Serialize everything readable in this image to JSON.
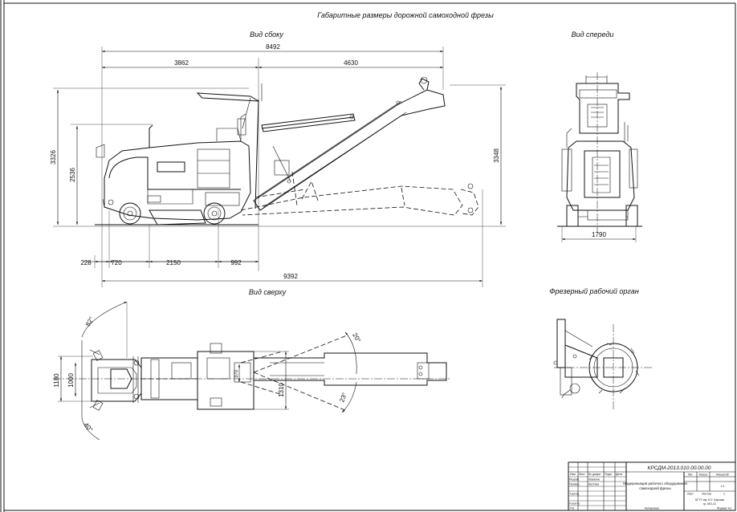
{
  "drawing": {
    "main_title": "Габаритные размеры дорожной самоходной фрезы",
    "views": {
      "side": "Вид сбоку",
      "front": "Вид спереди",
      "top": "Вид сверху",
      "cutter": "Фрезерный рабочий орган"
    }
  },
  "dimensions": {
    "side": {
      "overall_top": "8492",
      "upper_left": "3862",
      "upper_right": "4630",
      "height_total": "3326",
      "height_cab": "2536",
      "height_conveyor": "3348",
      "bottom_1": "228",
      "bottom_2": "720",
      "bottom_3": "2150",
      "bottom_4": "992",
      "overall_bottom": "9392"
    },
    "front": {
      "width": "1790"
    },
    "top": {
      "width_outer": "1180",
      "width_inner": "1000",
      "track": "1310",
      "small": "370",
      "angle_upper_left": "82°",
      "angle_lower_left": "40°",
      "angle_upper_right": "20°",
      "angle_lower_right": "23°"
    }
  },
  "title_block": {
    "designation": "КРСДМ-2013.010.00.00.00",
    "name_line1": "Модернизация рабочего оборудования",
    "name_line2": "самоходной фрезы",
    "col_lit": "Лит.",
    "col_mass": "Масса",
    "col_scale": "Масштаб",
    "scale_value": "1:1",
    "sheet": "Лист",
    "sheets": "Листов",
    "sheets_value": "1",
    "org_line1": "БГТУ им. В.Г. Шухова",
    "org_line2": "гр. МО-21",
    "copied": "Копировал",
    "format": "Формат А1",
    "roles": [
      "Изм.",
      "Лист",
      "№ докум.",
      "Подп.",
      "Дата",
      "Разраб.",
      "Провер.",
      "Т.контр.",
      "Н.контр.",
      "Утв."
    ],
    "names": [
      "Ковалев",
      "Кустова"
    ]
  }
}
